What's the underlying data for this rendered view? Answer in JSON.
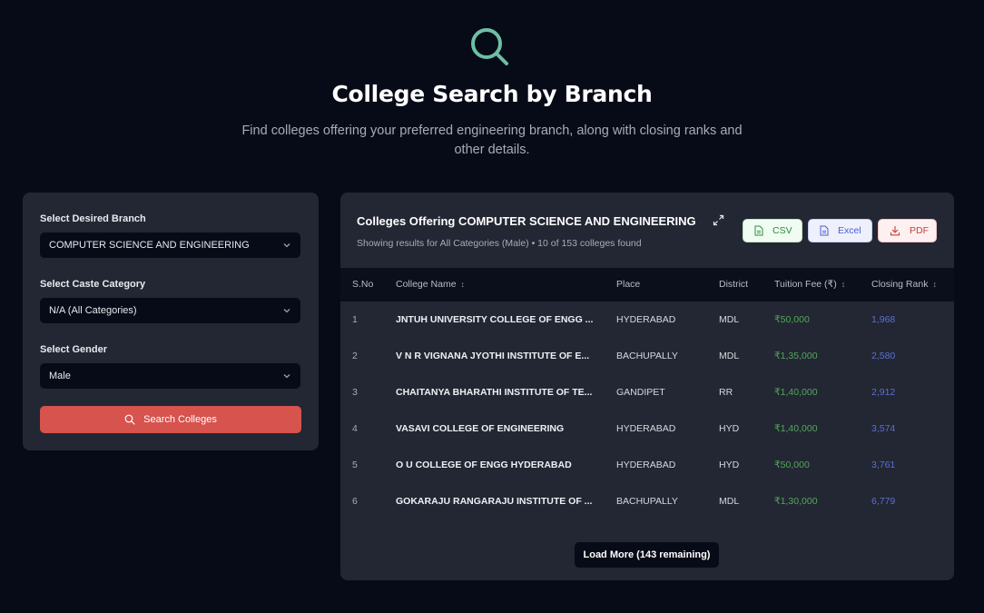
{
  "header": {
    "title": "College Search by Branch",
    "subtitle": "Find colleges offering your preferred engineering branch, along with closing ranks and other details."
  },
  "filters": {
    "branch_label": "Select Desired Branch",
    "branch_value": "COMPUTER SCIENCE AND ENGINEERING",
    "caste_label": "Select Caste Category",
    "caste_value": "N/A (All Categories)",
    "gender_label": "Select Gender",
    "gender_value": "Male",
    "search_label": "Search Colleges"
  },
  "results": {
    "title": "Colleges Offering COMPUTER SCIENCE AND ENGINEERING",
    "summary": "Showing results for All Categories (Male) • 10 of 153 colleges found",
    "export": {
      "csv": "CSV",
      "excel": "Excel",
      "pdf": "PDF"
    },
    "columns": {
      "sno": "S.No",
      "name": "College Name",
      "place": "Place",
      "district": "District",
      "fee": "Tuition Fee (₹)",
      "rank": "Closing Rank"
    },
    "rows": [
      {
        "sno": "1",
        "name": "JNTUH UNIVERSITY COLLEGE OF ENGG ...",
        "place": "HYDERABAD",
        "district": "MDL",
        "fee": "₹50,000",
        "rank": "1,968"
      },
      {
        "sno": "2",
        "name": "V N R VIGNANA JYOTHI INSTITUTE OF E...",
        "place": "BACHUPALLY",
        "district": "MDL",
        "fee": "₹1,35,000",
        "rank": "2,580"
      },
      {
        "sno": "3",
        "name": "CHAITANYA BHARATHI INSTITUTE OF TE...",
        "place": "GANDIPET",
        "district": "RR",
        "fee": "₹1,40,000",
        "rank": "2,912"
      },
      {
        "sno": "4",
        "name": "VASAVI COLLEGE OF ENGINEERING",
        "place": "HYDERABAD",
        "district": "HYD",
        "fee": "₹1,40,000",
        "rank": "3,574"
      },
      {
        "sno": "5",
        "name": "O U COLLEGE OF ENGG HYDERABAD",
        "place": "HYDERABAD",
        "district": "HYD",
        "fee": "₹50,000",
        "rank": "3,761"
      },
      {
        "sno": "6",
        "name": "GOKARAJU RANGARAJU INSTITUTE OF ...",
        "place": "BACHUPALLY",
        "district": "MDL",
        "fee": "₹1,30,000",
        "rank": "6,779"
      }
    ],
    "load_more": "Load More (143 remaining)"
  },
  "colors": {
    "background": "#070b17",
    "panel": "#232733",
    "accent_red": "#d6534e",
    "hero_icon": "#6dbfa4",
    "fee_green": "#52a85a",
    "rank_blue": "#5a6fd6"
  },
  "icons": [
    "search-icon",
    "chevron-down-icon",
    "expand-icon",
    "file-icon",
    "download-icon",
    "sort-icon"
  ]
}
